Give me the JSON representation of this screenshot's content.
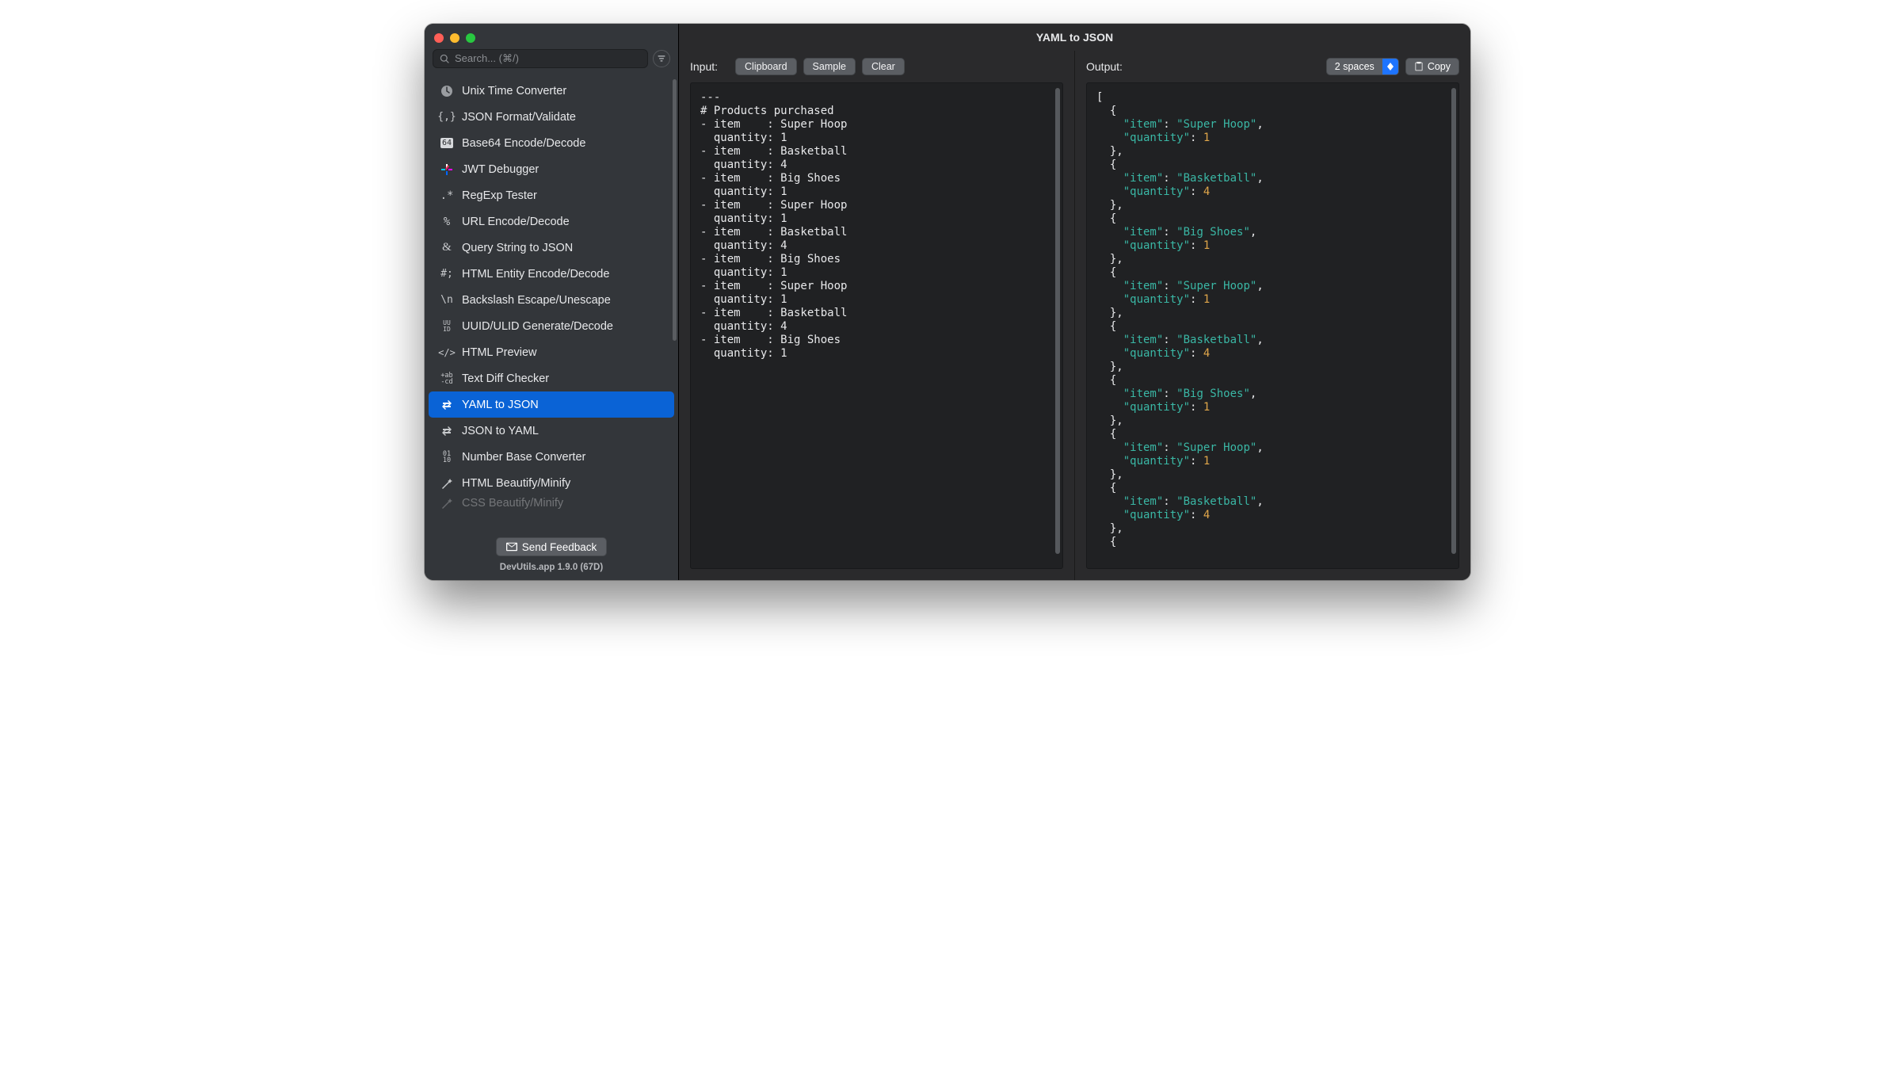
{
  "title": "YAML to JSON",
  "search": {
    "placeholder": "Search... (⌘/)"
  },
  "version": "DevUtils.app 1.9.0 (67D)",
  "feedback_label": "Send Feedback",
  "sidebar": {
    "items": [
      {
        "label": "Unix Time Converter",
        "icon": "clock-icon"
      },
      {
        "label": "JSON Format/Validate",
        "icon": "json-icon"
      },
      {
        "label": "Base64 Encode/Decode",
        "icon": "base64-icon"
      },
      {
        "label": "JWT Debugger",
        "icon": "jwt-icon"
      },
      {
        "label": "RegExp Tester",
        "icon": "regex-icon"
      },
      {
        "label": "URL Encode/Decode",
        "icon": "percent-icon"
      },
      {
        "label": "Query String to JSON",
        "icon": "ampersand-icon"
      },
      {
        "label": "HTML Entity Encode/Decode",
        "icon": "hash-icon"
      },
      {
        "label": "Backslash Escape/Unescape",
        "icon": "backslash-icon"
      },
      {
        "label": "UUID/ULID Generate/Decode",
        "icon": "uuid-icon"
      },
      {
        "label": "HTML Preview",
        "icon": "html-icon"
      },
      {
        "label": "Text Diff Checker",
        "icon": "diff-icon"
      },
      {
        "label": "YAML to JSON",
        "icon": "swap-icon",
        "selected": true
      },
      {
        "label": "JSON to YAML",
        "icon": "swap-icon"
      },
      {
        "label": "Number Base Converter",
        "icon": "binary-icon"
      },
      {
        "label": "HTML Beautify/Minify",
        "icon": "wand-icon"
      },
      {
        "label": "CSS Beautify/Minify",
        "icon": "wand-icon",
        "cutoff": true
      }
    ]
  },
  "input": {
    "label": "Input:",
    "buttons": {
      "clipboard": "Clipboard",
      "sample": "Sample",
      "clear": "Clear"
    },
    "lines": [
      "---",
      "# Products purchased",
      "- item    : Super Hoop",
      "  quantity: 1",
      "- item    : Basketball",
      "  quantity: 4",
      "- item    : Big Shoes",
      "  quantity: 1",
      "- item    : Super Hoop",
      "  quantity: 1",
      "- item    : Basketball",
      "  quantity: 4",
      "- item    : Big Shoes",
      "  quantity: 1",
      "- item    : Super Hoop",
      "  quantity: 1",
      "- item    : Basketball",
      "  quantity: 4",
      "- item    : Big Shoes",
      "  quantity: 1"
    ]
  },
  "output": {
    "label": "Output:",
    "indent": "2 spaces",
    "copy_label": "Copy",
    "json": [
      {
        "item": "Super Hoop",
        "quantity": 1
      },
      {
        "item": "Basketball",
        "quantity": 4
      },
      {
        "item": "Big Shoes",
        "quantity": 1
      },
      {
        "item": "Super Hoop",
        "quantity": 1
      },
      {
        "item": "Basketball",
        "quantity": 4
      },
      {
        "item": "Big Shoes",
        "quantity": 1
      },
      {
        "item": "Super Hoop",
        "quantity": 1
      },
      {
        "item": "Basketball",
        "quantity": 4
      }
    ]
  }
}
